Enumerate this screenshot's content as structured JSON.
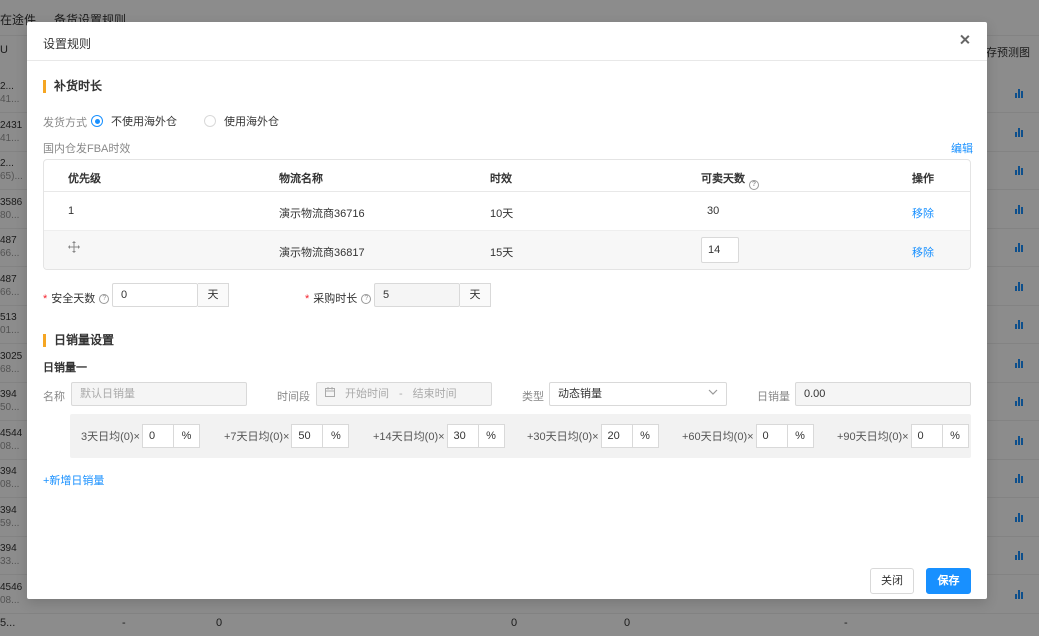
{
  "background": {
    "tabs": [
      "在途件",
      "备货设置规则"
    ],
    "col_label_left": "U",
    "col_label_right": "存预测图",
    "rows": [
      {
        "id": "2...",
        "sub": "41..."
      },
      {
        "id": "2431",
        "sub": "41..."
      },
      {
        "id": "2...",
        "sub": "65)..."
      },
      {
        "id": "3586",
        "sub": "80..."
      },
      {
        "id": "487",
        "sub": "66..."
      },
      {
        "id": "487",
        "sub": "66..."
      },
      {
        "id": "513",
        "sub": "01..."
      },
      {
        "id": "3025",
        "sub": "68..."
      },
      {
        "id": "394",
        "sub": "50..."
      },
      {
        "id": "4544",
        "sub": "08..."
      },
      {
        "id": "394",
        "sub": "08..."
      },
      {
        "id": "394",
        "sub": "59..."
      },
      {
        "id": "394",
        "sub": "33..."
      },
      {
        "id": "4546",
        "sub": "08..."
      }
    ],
    "footer": {
      "first": "5...",
      "c1": "-",
      "c2": "0",
      "c3": "0",
      "c4": "0",
      "c5": "-"
    }
  },
  "modal": {
    "title": "设置规则",
    "replenish": {
      "section_title": "补货时长",
      "ship_method_label": "发货方式",
      "options": [
        "不使用海外仓",
        "使用海外仓"
      ],
      "selected_option": "不使用海外仓",
      "fba_label": "国内仓发FBA时效",
      "edit_link": "编辑",
      "table": {
        "headers": [
          "优先级",
          "物流名称",
          "时效",
          "可卖天数",
          "操作"
        ],
        "rows": [
          {
            "priority": "1",
            "name": "演示物流商36716",
            "time": "10天",
            "days": "30",
            "action": "移除"
          },
          {
            "priority": "",
            "name": "演示物流商36817",
            "time": "15天",
            "days": "14",
            "action": "移除"
          }
        ]
      },
      "safety_label": "安全天数",
      "safety_value": "0",
      "safety_unit": "天",
      "purchase_label": "采购时长",
      "purchase_value": "5",
      "purchase_unit": "天"
    },
    "daily": {
      "section_title": "日销量设置",
      "sub_title": "日销量一",
      "name_label": "名称",
      "name_placeholder": "默认日销量",
      "period_label": "时间段",
      "start_placeholder": "开始时间",
      "range_sep": "-",
      "end_placeholder": "结束时间",
      "type_label": "类型",
      "type_value": "动态销量",
      "daily_label": "日销量",
      "daily_value": "0.00",
      "weights": [
        {
          "label": "3天日均(0)×",
          "value": "0",
          "unit": "%"
        },
        {
          "label": "+7天日均(0)×",
          "value": "50",
          "unit": "%"
        },
        {
          "label": "+14天日均(0)×",
          "value": "30",
          "unit": "%"
        },
        {
          "label": "+30天日均(0)×",
          "value": "20",
          "unit": "%"
        },
        {
          "label": "+60天日均(0)×",
          "value": "0",
          "unit": "%"
        },
        {
          "label": "+90天日均(0)×",
          "value": "0",
          "unit": "%"
        }
      ],
      "add_link": "+新增日销量"
    },
    "footer": {
      "cancel": "关闭",
      "save": "保存"
    }
  }
}
